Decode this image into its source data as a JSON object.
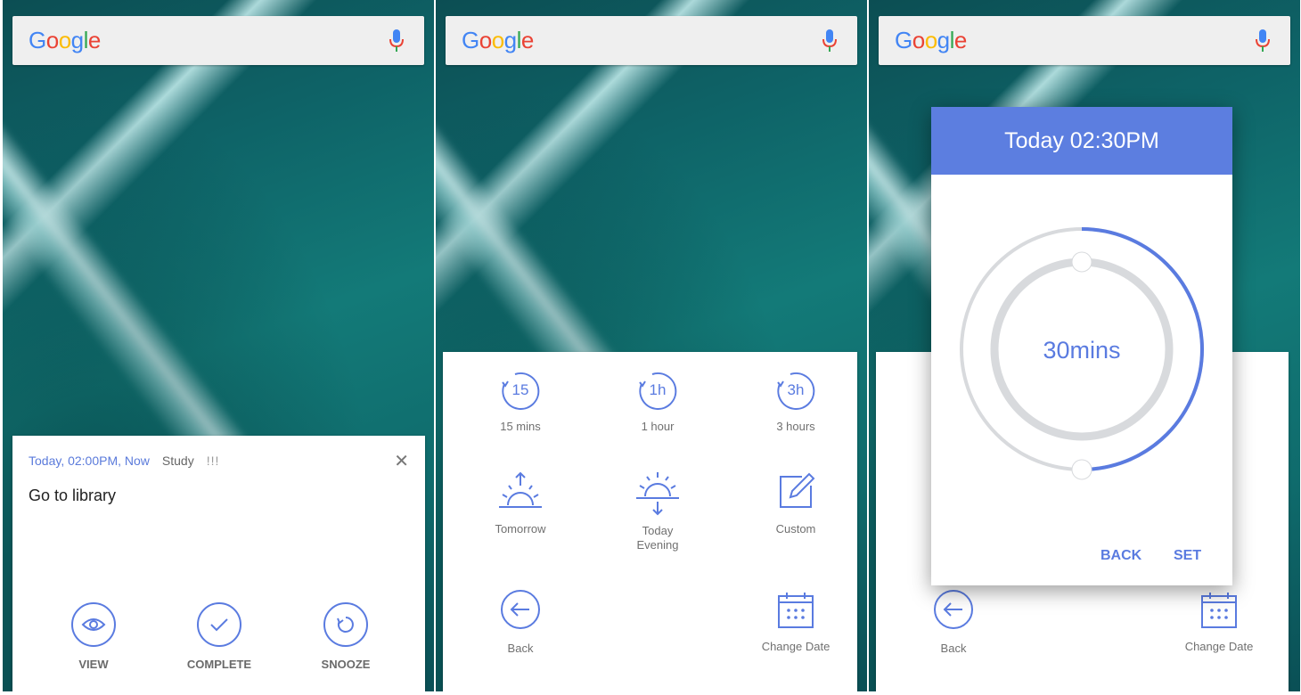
{
  "search": {
    "logo_letters": [
      "G",
      "o",
      "o",
      "g",
      "l",
      "e"
    ],
    "logo_colors": [
      "#4285f4",
      "#ea4335",
      "#fbbc05",
      "#4285f4",
      "#34a853",
      "#ea4335"
    ]
  },
  "notification": {
    "time": "Today, 02:00PM, Now",
    "category": "Study",
    "priority": "!!!",
    "close": "✕",
    "title": "Go to library",
    "actions": [
      {
        "label": "VIEW",
        "icon": "eye-icon"
      },
      {
        "label": "COMPLETE",
        "icon": "checkmark-icon"
      },
      {
        "label": "SNOOZE",
        "icon": "snooze-icon"
      }
    ]
  },
  "snooze_options": {
    "quick": [
      {
        "ring_text": "15",
        "label": "15 mins"
      },
      {
        "ring_text": "1h",
        "label": "1 hour"
      },
      {
        "ring_text": "3h",
        "label": "3 hours"
      }
    ],
    "tomorrow": "Tomorrow",
    "today_evening_line1": "Today",
    "today_evening_line2": "Evening",
    "custom": "Custom",
    "back": "Back",
    "change_date": "Change Date"
  },
  "dialog": {
    "title": "Today 02:30PM",
    "duration": "30mins",
    "progress_fraction": 0.5,
    "back_button": "BACK",
    "set_button": "SET"
  },
  "colors": {
    "accent": "#5a7be0",
    "header": "#5c7ee0",
    "ring_track": "#d8dadd"
  }
}
